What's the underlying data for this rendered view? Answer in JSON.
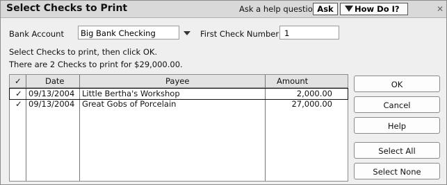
{
  "title": "Select Checks to Print",
  "help": {
    "question": "Ask a help question",
    "ask_label": "Ask",
    "howdoi_label": "How Do I?",
    "close_glyph": "✕"
  },
  "form": {
    "bank_label": "Bank Account",
    "bank_value": "Big Bank Checking",
    "first_check_label": "First Check Number",
    "first_check_value": "1"
  },
  "instructions": "Select Checks to print, then click OK.",
  "count_text": "There are 2 Checks to print for $29,000.00.",
  "table": {
    "headers": {
      "check": "✓",
      "date": "Date",
      "payee": "Payee",
      "amount": "Amount"
    },
    "rows": [
      {
        "check": "✓",
        "date": "09/13/2004",
        "payee": "Little Bertha's Workshop",
        "amount": "2,000.00"
      },
      {
        "check": "✓",
        "date": "09/13/2004",
        "payee": "Great Gobs of Porcelain",
        "amount": "27,000.00"
      }
    ]
  },
  "buttons": {
    "ok": "OK",
    "cancel": "Cancel",
    "help": "Help",
    "select_all": "Select All",
    "select_none": "Select None"
  }
}
